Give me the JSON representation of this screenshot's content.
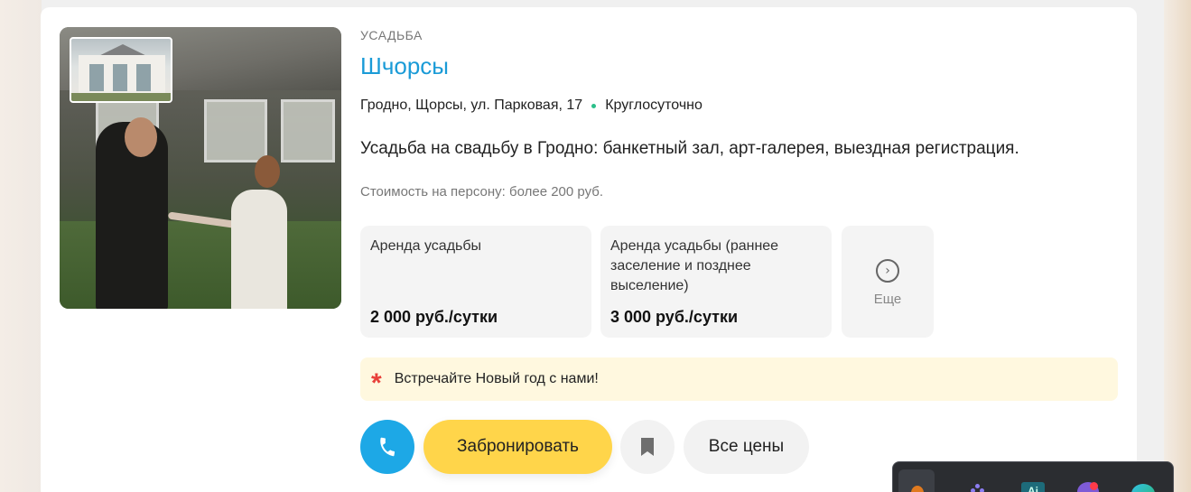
{
  "listing": {
    "category": "УСАДЬБА",
    "title": "Шчорсы",
    "address": "Гродно, Щорсы, ул. Парковая, 17",
    "hours": "Круглосуточно",
    "description": "Усадьба на свадьбу в Гродно: банкетный зал, арт-галерея, выездная регистрация.",
    "price_note": "Стоимость на персону: более 200 руб.",
    "tiles": [
      {
        "label": "Аренда усадьбы",
        "price": "2 000 руб./сутки"
      },
      {
        "label": "Аренда усадьбы (раннее заселение и позднее выселение)",
        "price": "3 000 руб./сутки"
      }
    ],
    "more_label": "Еще",
    "promo": "Встречайте Новый год с нами!",
    "buttons": {
      "book": "Забронировать",
      "all_prices": "Все цены"
    }
  },
  "taskbar": {
    "ai_label": "Ai"
  },
  "colors": {
    "title": "#1a9bd7",
    "phone_button": "#1da8e6",
    "book_button": "#ffd54a",
    "promo_bg": "#fff8df",
    "promo_star": "#e8403a",
    "hours_dot": "#2bbf8a"
  },
  "icons": {
    "phone": "phone-icon",
    "bookmark": "bookmark-icon",
    "more": "chevron-right-circle-icon",
    "star": "asterisk-icon"
  }
}
